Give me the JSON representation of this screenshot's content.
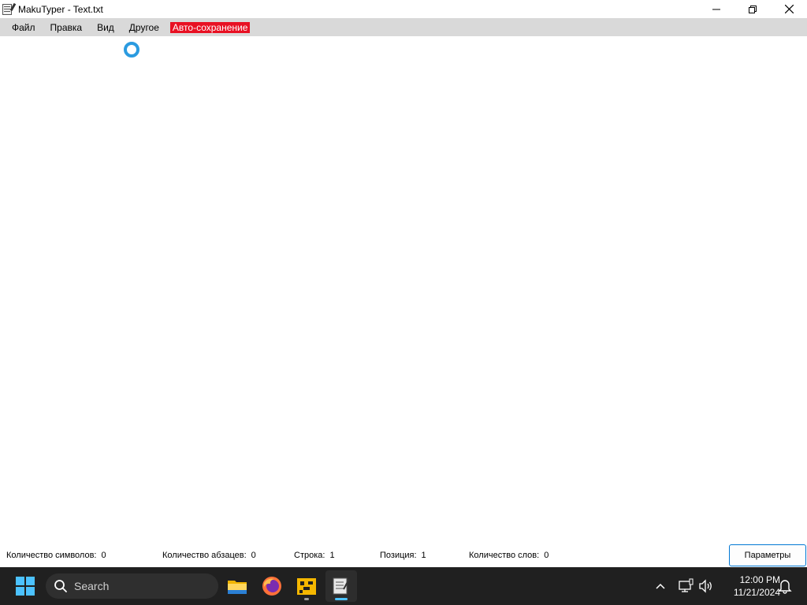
{
  "window": {
    "title": "MakuTyper - Text.txt",
    "controls": [
      "minimize",
      "restore",
      "close"
    ]
  },
  "menu": {
    "items": [
      {
        "label": "Файл"
      },
      {
        "label": "Правка"
      },
      {
        "label": "Вид"
      },
      {
        "label": "Другое"
      }
    ],
    "autosave_label": "Авто-сохранение",
    "autosave_color": "#e81123"
  },
  "editor": {
    "content": ""
  },
  "status": {
    "chars_label": "Количество символов:",
    "chars_value": "0",
    "paragraphs_label": "Количество абзацев:",
    "paragraphs_value": "0",
    "line_label": "Строка:",
    "line_value": "1",
    "position_label": "Позиция:",
    "position_value": "1",
    "words_label": "Количество слов:",
    "words_value": "0",
    "params_button": "Параметры"
  },
  "taskbar": {
    "search_placeholder": "Search",
    "apps": [
      "file-explorer-icon",
      "firefox-icon",
      "yellow-app-icon",
      "makutyper-icon"
    ],
    "time": "12:00 PM",
    "date": "11/21/2024",
    "accent": "#4cc2ff"
  }
}
